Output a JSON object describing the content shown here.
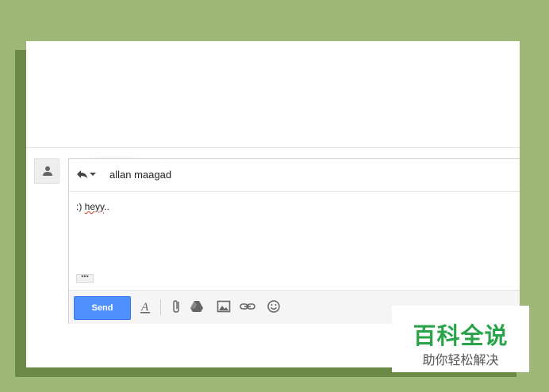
{
  "reply": {
    "recipient": "allan maagad",
    "icons": [
      "reply-icon",
      "chevron-down-icon"
    ]
  },
  "compose": {
    "body_prefix": ":) ",
    "body_misspelled": "heyy",
    "body_suffix": "..",
    "trimmed_content": "•••"
  },
  "toolbar": {
    "send_label": "Send",
    "icons": [
      "format-text-icon",
      "attach-icon",
      "drive-icon",
      "image-icon",
      "link-icon",
      "emoji-icon"
    ]
  },
  "watermark": {
    "title": "百科全说",
    "subtitle": "助你轻松解决"
  },
  "colors": {
    "background": "#9db877",
    "shadow": "#6b8a45",
    "send_button": "#4d90fe",
    "watermark_green": "#2aa44a"
  }
}
